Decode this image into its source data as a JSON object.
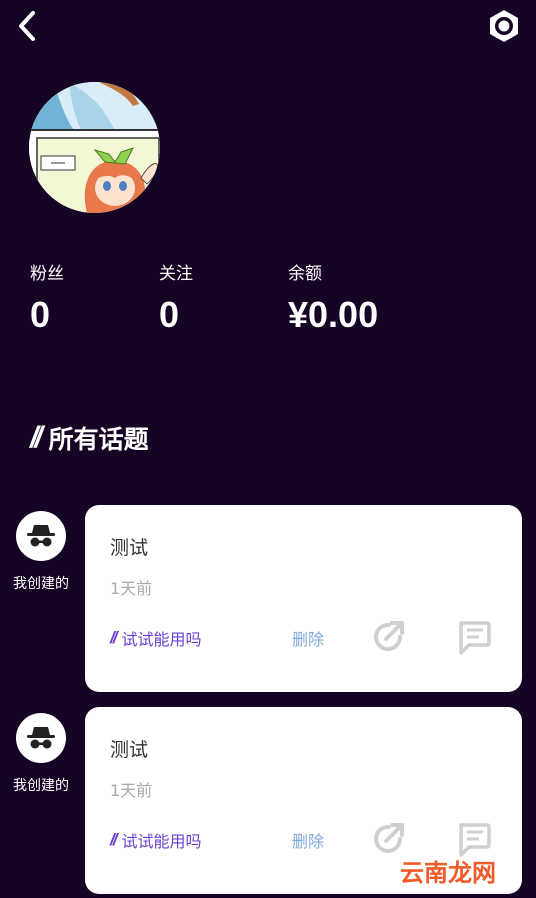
{
  "header": {
    "back_icon": "chevron-left-icon",
    "settings_icon": "settings-ring-icon"
  },
  "profile": {
    "avatar": "anime-comic-avatar",
    "stats": [
      {
        "label": "粉丝",
        "value": "0"
      },
      {
        "label": "关注",
        "value": "0"
      },
      {
        "label": "余额",
        "value": "¥0.00"
      }
    ]
  },
  "section": {
    "marker": "//",
    "title": "所有话题"
  },
  "topics": [
    {
      "creator_label": "我创建的",
      "creator_icon": "incognito-icon",
      "title": "测试",
      "time": "1天前",
      "tag_marker": "//",
      "tag": "试试能用吗",
      "delete_label": "删除",
      "share_icon": "share-arrow-icon",
      "comment_icon": "comment-icon"
    },
    {
      "creator_label": "我创建的",
      "creator_icon": "incognito-icon",
      "title": "测试",
      "time": "1天前",
      "tag_marker": "//",
      "tag": "试试能用吗",
      "delete_label": "删除",
      "share_icon": "share-arrow-icon",
      "comment_icon": "comment-icon"
    }
  ],
  "watermark": {
    "text": "云南龙网"
  },
  "colors": {
    "background": "#150424",
    "card": "#ffffff",
    "tag": "#6b3fcf",
    "delete": "#7fa8d8",
    "muted": "#aaaaaa",
    "watermark": "#f05a28"
  }
}
